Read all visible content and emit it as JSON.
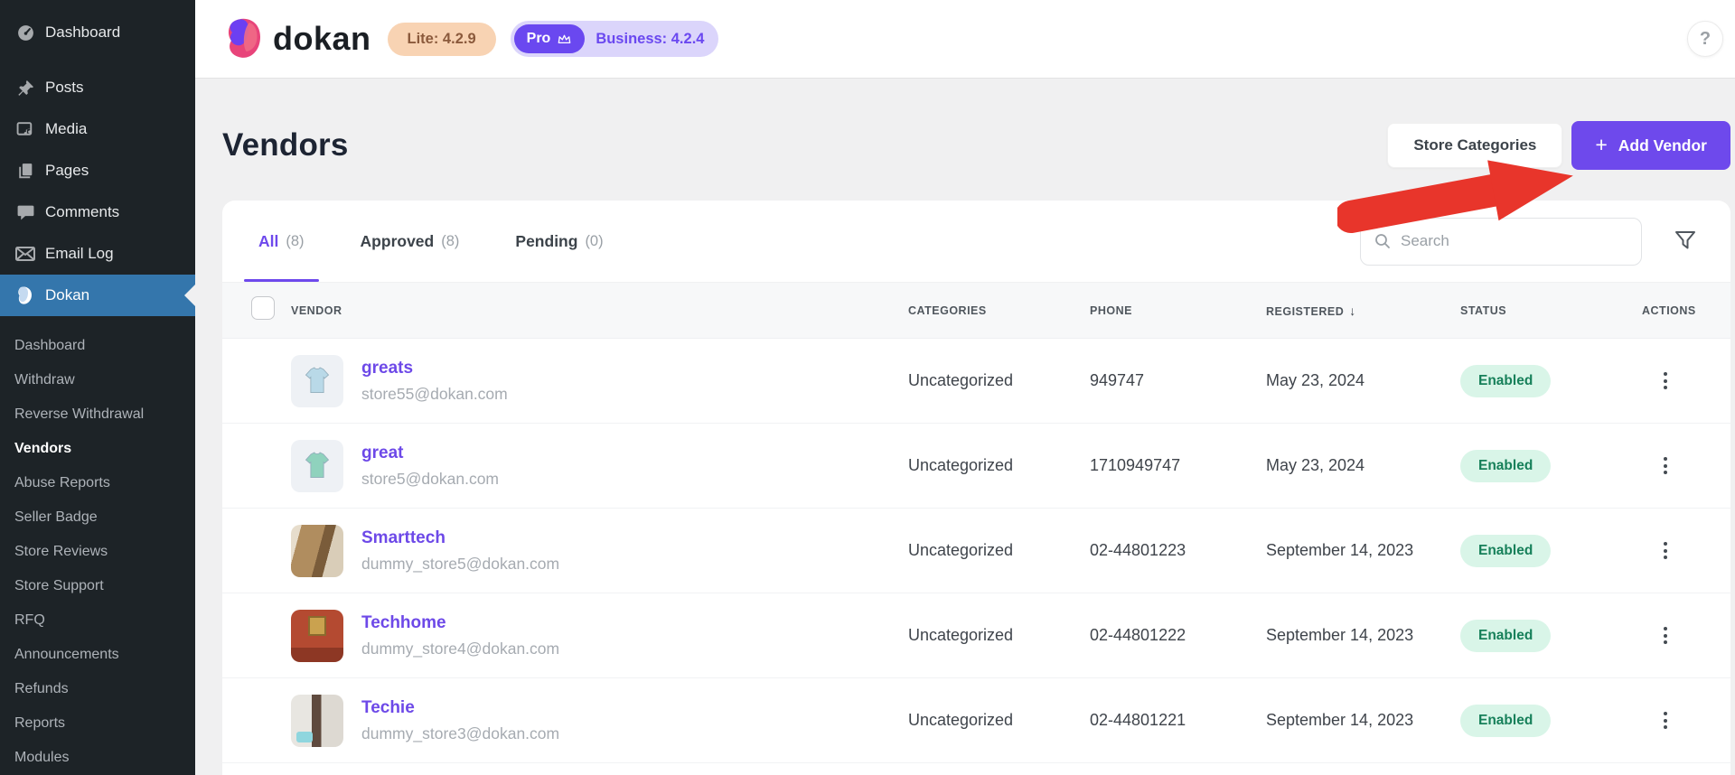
{
  "sidebar": {
    "items": [
      {
        "label": "Dashboard",
        "icon": "dashboard-icon",
        "active": false
      },
      {
        "label": "Posts",
        "icon": "pushpin-icon",
        "active": false
      },
      {
        "label": "Media",
        "icon": "media-icon",
        "active": false
      },
      {
        "label": "Pages",
        "icon": "pages-icon",
        "active": false
      },
      {
        "label": "Comments",
        "icon": "comment-icon",
        "active": false
      },
      {
        "label": "Email Log",
        "icon": "email-icon",
        "active": false
      },
      {
        "label": "Dokan",
        "icon": "dokan-icon",
        "active": true
      }
    ],
    "submenu": [
      "Dashboard",
      "Withdraw",
      "Reverse Withdrawal",
      "Vendors",
      "Abuse Reports",
      "Seller Badge",
      "Store Reviews",
      "Store Support",
      "RFQ",
      "Announcements",
      "Refunds",
      "Reports",
      "Modules"
    ],
    "active_submenu": "Vendors"
  },
  "header": {
    "logo_text": "dokan",
    "lite_badge": "Lite: 4.2.9",
    "pro_badge": "Pro",
    "business_badge": "Business: 4.2.4",
    "help": "?"
  },
  "page": {
    "title": "Vendors",
    "store_categories_button": "Store Categories",
    "add_vendor_plus": "+",
    "add_vendor_label": "Add Vendor"
  },
  "tabs": [
    {
      "label": "All",
      "count": "(8)",
      "active": true
    },
    {
      "label": "Approved",
      "count": "(8)",
      "active": false
    },
    {
      "label": "Pending",
      "count": "(0)",
      "active": false
    }
  ],
  "search": {
    "placeholder": "Search"
  },
  "table": {
    "columns": [
      "Vendor",
      "Categories",
      "Phone",
      "Registered",
      "Status",
      "Actions"
    ],
    "sort_column": "Registered",
    "sort_arrow": "↓",
    "rows": [
      {
        "name": "greats",
        "email": "store55@dokan.com",
        "category": "Uncategorized",
        "phone": "949747",
        "registered": "May 23, 2024",
        "status": "Enabled",
        "avatar": "tshirt-blue"
      },
      {
        "name": "great",
        "email": "store5@dokan.com",
        "category": "Uncategorized",
        "phone": "1710949747",
        "registered": "May 23, 2024",
        "status": "Enabled",
        "avatar": "tshirt-teal"
      },
      {
        "name": "Smarttech",
        "email": "dummy_store5@dokan.com",
        "category": "Uncategorized",
        "phone": "02-44801223",
        "registered": "September 14, 2023",
        "status": "Enabled",
        "avatar": "photo-shelf"
      },
      {
        "name": "Techhome",
        "email": "dummy_store4@dokan.com",
        "category": "Uncategorized",
        "phone": "02-44801222",
        "registered": "September 14, 2023",
        "status": "Enabled",
        "avatar": "photo-red-room"
      },
      {
        "name": "Techie",
        "email": "dummy_store3@dokan.com",
        "category": "Uncategorized",
        "phone": "02-44801221",
        "registered": "September 14, 2023",
        "status": "Enabled",
        "avatar": "photo-white-room"
      }
    ]
  },
  "colors": {
    "accent_purple": "#6e49ec",
    "annotation_red": "#e8352b",
    "sidebar_bg": "#1d2327",
    "sidebar_active_blue": "#3476ac",
    "enabled_badge_bg": "#d9f5e8",
    "enabled_badge_text": "#17805a",
    "lite_badge_bg": "#f8d3b3",
    "lite_badge_text": "#8b5a3c",
    "business_badge_bg": "#dbd5fb"
  }
}
